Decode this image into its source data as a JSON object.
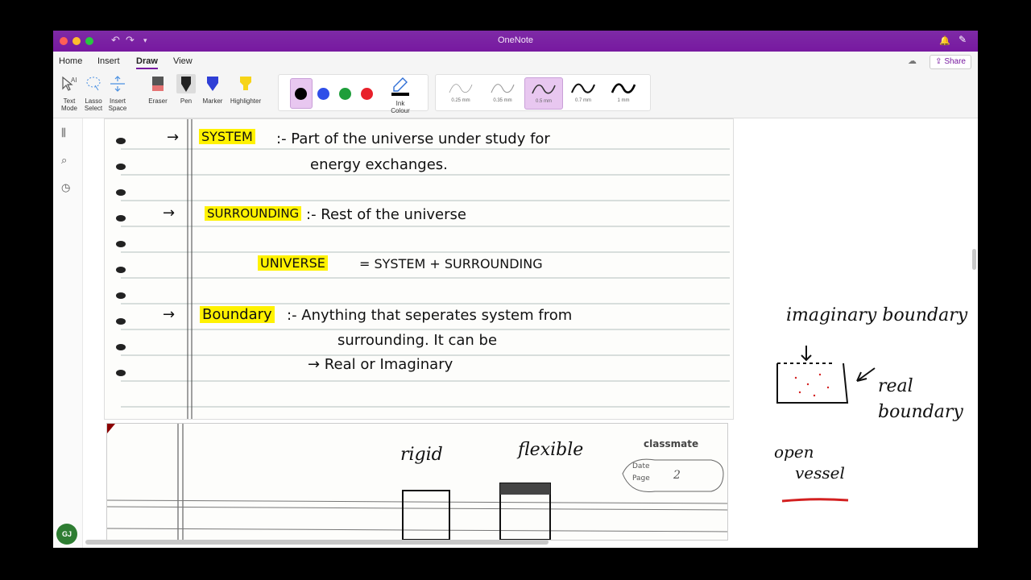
{
  "app": {
    "title": "OneNote"
  },
  "tabs": [
    {
      "label": "Home"
    },
    {
      "label": "Insert"
    },
    {
      "label": "Draw",
      "active": true
    },
    {
      "label": "View"
    }
  ],
  "share": {
    "label": "Share"
  },
  "tools": {
    "text_mode": "Text Mode",
    "lasso_select": "Lasso Select",
    "insert_space": "Insert Space",
    "eraser": "Eraser",
    "pen": "Pen",
    "marker": "Marker",
    "highlighter": "Highlighter",
    "ink_colour": "Ink Colour"
  },
  "pen_colors": [
    "#000000",
    "#2f4fe8",
    "#1e9e3a",
    "#e8202a"
  ],
  "thicknesses": [
    {
      "label": "0.25 mm"
    },
    {
      "label": "0.35 mm"
    },
    {
      "label": "0.5 mm",
      "selected": true
    },
    {
      "label": "0.7 mm"
    },
    {
      "label": "1 mm"
    }
  ],
  "user": {
    "initials": "GJ"
  },
  "note1": {
    "system_term": "SYSTEM",
    "system_def1": ":- Part of the universe under study for",
    "system_def2": "energy exchanges.",
    "surrounding_term": "SURROUNDING",
    "surrounding_def": ":- Rest of the universe",
    "universe_term": "UNIVERSE",
    "universe_eq": "= SYSTEM + SURROUNDING",
    "boundary_term": "Boundary",
    "boundary_def1": ":- Anything that seperates system from",
    "boundary_def2": "surrounding. It can be",
    "boundary_def3": "→ Real or Imaginary",
    "arrow": "→"
  },
  "note2": {
    "rigid": "rigid",
    "flexible": "flexible",
    "brand": "classmate",
    "date_label": "Date",
    "page_label": "Page",
    "page_num": "2"
  },
  "ink": {
    "imaginary": "imaginary boundary",
    "real1": "real",
    "real2": "boundary",
    "open1": "open",
    "open2": "vessel"
  }
}
